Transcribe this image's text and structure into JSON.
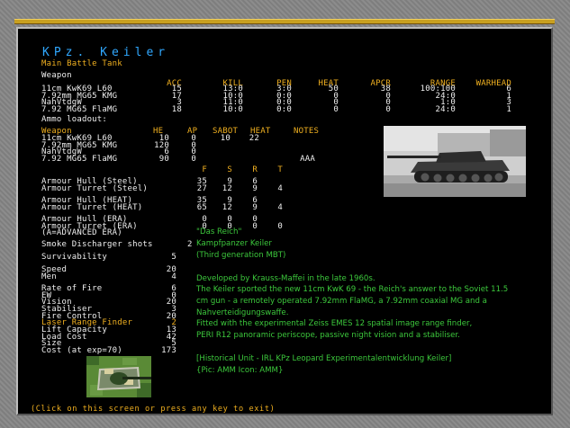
{
  "unit": {
    "name": "KPz. Keiler",
    "role": "Main Battle Tank"
  },
  "weapons": {
    "heading": "Weapon",
    "columns": [
      "ACC",
      "KILL",
      "PEN",
      "HEAT",
      "APCR",
      "RANGE",
      "WARHEAD"
    ],
    "rows": [
      [
        "11cm KwK69 L60",
        "15",
        "13:0",
        "3:0",
        "50",
        "38",
        "100:100",
        "6"
      ],
      [
        "7.92mm MG65 KMG",
        "17",
        "10:0",
        "0:0",
        "0",
        "0",
        "24:0",
        "1"
      ],
      [
        "NahVtdgW",
        "3",
        "11:0",
        "0:0",
        "0",
        "0",
        "1:0",
        "3"
      ],
      [
        "7.92 MG65 FlaMG",
        "18",
        "10:0",
        "0:0",
        "0",
        "0",
        "24:0",
        "1"
      ]
    ]
  },
  "ammo": {
    "title": "Ammo loadout:",
    "heading": "Weapon",
    "columns": [
      "HE",
      "AP",
      "SABOT",
      "HEAT",
      "NOTES"
    ],
    "rows": [
      [
        "11cm KwK69 L60",
        "10",
        "0",
        "10",
        "22",
        ""
      ],
      [
        "7.92mm MG65 KMG",
        "120",
        "0",
        "",
        "",
        ""
      ],
      [
        "NahVtdgW",
        "6",
        "0",
        "",
        "",
        ""
      ],
      [
        "7.92 MG65 FlaMG",
        "90",
        "0",
        "",
        "",
        "AAA"
      ]
    ]
  },
  "armour": {
    "columns": [
      "F",
      "S",
      "R",
      "T"
    ],
    "rows": [
      [
        "Armour Hull (Steel)",
        "35",
        "9",
        "6",
        ""
      ],
      [
        "Armour Turret (Steel)",
        "27",
        "12",
        "9",
        "4"
      ],
      [
        "Armour Hull (HEAT)",
        "35",
        "9",
        "6",
        ""
      ],
      [
        "Armour Turret (HEAT)",
        "65",
        "12",
        "9",
        "4"
      ],
      [
        "Armour Hull (ERA)",
        "0",
        "0",
        "0",
        ""
      ],
      [
        "Armour Turret (ERA)",
        "0",
        "0",
        "0",
        "0"
      ]
    ],
    "note": "(A=ADVANCED ERA)"
  },
  "smoke": {
    "label": "Smoke Discharger shots",
    "value": "2"
  },
  "survivability": {
    "label": "Survivability",
    "value": "5"
  },
  "stats": [
    {
      "label": "Speed",
      "value": "20",
      "highlight": false
    },
    {
      "label": "Men",
      "value": "4",
      "highlight": false
    },
    {
      "label": "Rate of Fire",
      "value": "6",
      "highlight": false
    },
    {
      "label": "EW",
      "value": "0",
      "highlight": false
    },
    {
      "label": "Vision",
      "value": "20",
      "highlight": false
    },
    {
      "label": "Stabiliser",
      "value": "3",
      "highlight": false
    },
    {
      "label": "Fire Control",
      "value": "20",
      "highlight": false
    },
    {
      "label": "Laser Range Finder",
      "value": "2",
      "highlight": true
    },
    {
      "label": "Lift Capacity",
      "value": "13",
      "highlight": false
    },
    {
      "label": "Load Cost",
      "value": "42",
      "highlight": false
    },
    {
      "label": "Size",
      "value": "5",
      "highlight": false
    },
    {
      "label": "Cost (at exp=70)",
      "value": "173",
      "highlight": false
    }
  ],
  "description": {
    "lines": [
      "\"Das Reich\"",
      "Kampfpanzer Keiler",
      "(Third generation MBT)",
      "",
      "Developed by Krauss-Maffei in the late 1960s.",
      "The Keiler sported the new 11cm KwK 69 - the Reich's answer to the Soviet 11.5",
      "cm gun - a remotely operated 7.92mm FlaMG, a 7.92mm coaxial MG and a",
      "Nahverteidigungswaffe.",
      "Fitted with the experimental Zeiss EMES 12 spatial image range finder,",
      "PERI R12 panoramic periscope, passive night vision and a stabiliser.",
      "",
      "[Historical Unit - IRL KPz Leopard Experimentalentwicklung Keiler]",
      "{Pic: AMM Icon: AMM}"
    ]
  },
  "footer": "(Click on this screen or press any key to exit)",
  "colors": {
    "accent": "#f0b020",
    "title": "#30a8ff",
    "text": "#e8e8e8",
    "description": "#3cc83c",
    "background": "#000000"
  }
}
